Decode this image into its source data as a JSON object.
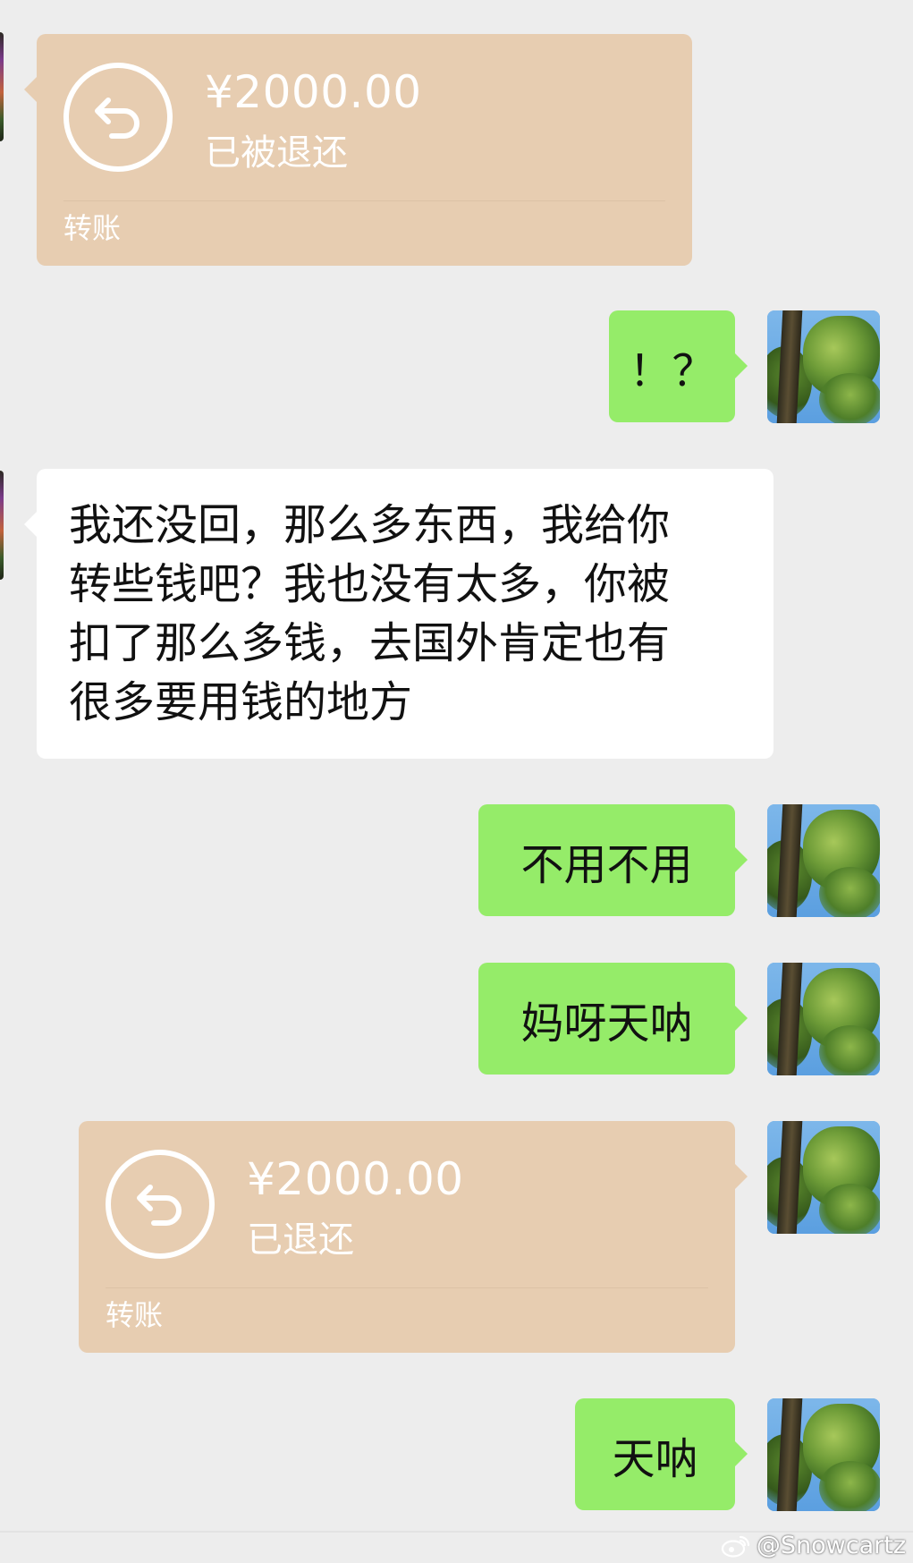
{
  "messages": {
    "transfer_in": {
      "amount": "¥2000.00",
      "status": "已被退还",
      "label": "转账"
    },
    "msg_exclaim": "！？",
    "long_message": {
      "lines": [
        "我还没回，那么多东西，我给你",
        "转些钱吧？我也没有太多，你被",
        "扣了那么多钱，去国外肯定也有",
        "很多要用钱的地方"
      ]
    },
    "msg_no_need": "不用不用",
    "msg_mama": "妈呀天呐",
    "transfer_out": {
      "amount": "¥2000.00",
      "status": "已退还",
      "label": "转账"
    },
    "msg_tiannа": "天呐"
  },
  "watermark": {
    "icon": "weibo-icon",
    "text": "@Snowcartz"
  },
  "colors": {
    "background": "#ededed",
    "transfer_card": "#e7cdb1",
    "my_bubble": "#95ec69",
    "their_bubble": "#ffffff"
  }
}
